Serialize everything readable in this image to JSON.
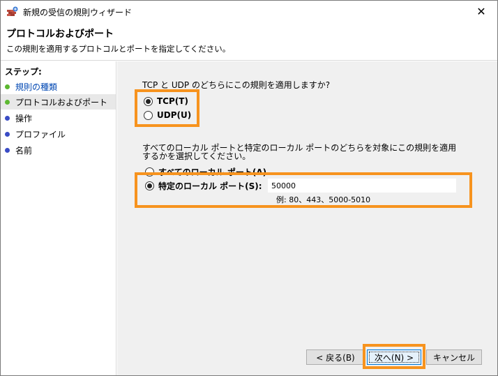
{
  "window": {
    "title": "新規の受信の規則ウィザード",
    "close_glyph": "✕"
  },
  "header": {
    "title": "プロトコルおよびポート",
    "description": "この規則を適用するプロトコルとポートを指定してください。"
  },
  "sidebar": {
    "steps_label": "ステップ:",
    "items": [
      {
        "label": "規則の種類",
        "dot_color": "#5cb830",
        "state": "done"
      },
      {
        "label": "プロトコルおよびポート",
        "dot_color": "#5cb830",
        "state": "current"
      },
      {
        "label": "操作",
        "dot_color": "#3a4cc5",
        "state": "pending"
      },
      {
        "label": "プロファイル",
        "dot_color": "#3a4cc5",
        "state": "pending"
      },
      {
        "label": "名前",
        "dot_color": "#3a4cc5",
        "state": "pending"
      }
    ]
  },
  "protocol": {
    "question": "TCP と UDP のどちらにこの規則を適用しますか?",
    "tcp_label": "TCP(T)",
    "udp_label": "UDP(U)",
    "selected": "tcp"
  },
  "ports": {
    "question": "すべてのローカル ポートと特定のローカル ポートのどちらを対象にこの規則を適用するかを選択してください。",
    "all_label": "すべてのローカル ポート(A)",
    "specific_label": "特定のローカル ポート(S):",
    "selected": "specific",
    "value": "50000",
    "example": "例: 80、443、5000-5010"
  },
  "buttons": {
    "back": "< 戻る(B)",
    "next": "次へ(N) >",
    "cancel": "キャンセル"
  },
  "colors": {
    "highlight": "#f7931e",
    "done_dot": "#5cb830",
    "pending_dot": "#3a4cc5",
    "link_blue": "#0047b3"
  }
}
